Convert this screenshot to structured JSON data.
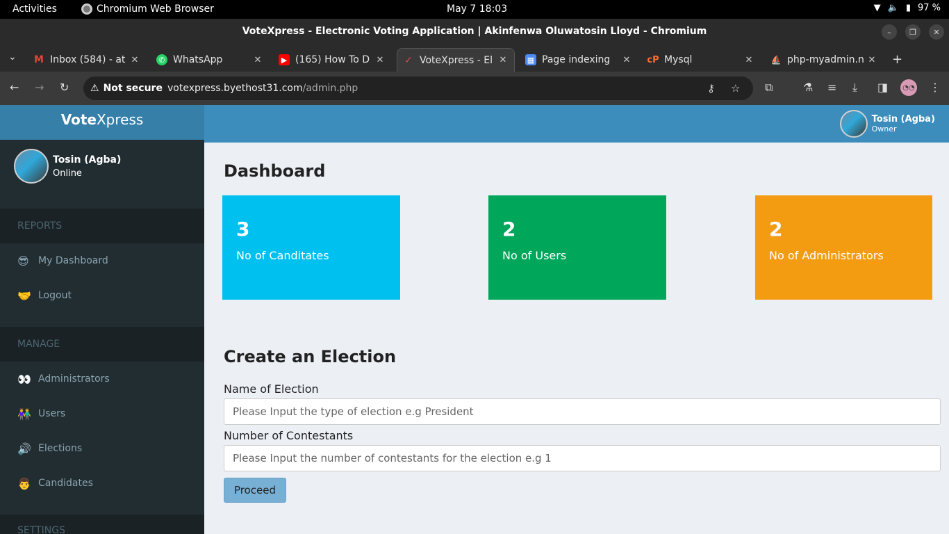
{
  "system": {
    "activities": "Activities",
    "app_name": "Chromium Web Browser",
    "clock": "May 7  18:03",
    "battery": "97 %"
  },
  "window": {
    "title": "VoteXpress - Electronic Voting Application | Akinfenwa Oluwatosin Lloyd - Chromium"
  },
  "tabs": [
    {
      "title": "Inbox (584) - at",
      "icon": "gmail-icon"
    },
    {
      "title": "WhatsApp",
      "icon": "whatsapp-icon"
    },
    {
      "title": "(165) How To D",
      "icon": "youtube-icon"
    },
    {
      "title": "VoteXpress - El",
      "icon": "votexpress-icon",
      "active": true
    },
    {
      "title": "Page indexing",
      "icon": "search-console-icon"
    },
    {
      "title": "Mysql",
      "icon": "cpanel-icon"
    },
    {
      "title": "php-myadmin.n",
      "icon": "phpmyadmin-icon"
    }
  ],
  "toolbar": {
    "security": "Not secure",
    "url_host": "votexpress.byethost31.com",
    "url_path": "/admin.php"
  },
  "app": {
    "logo_bold": "Vote",
    "logo_rest": "Xpress",
    "header_user_name": "Tosin (Agba)",
    "header_user_role": "Owner",
    "sidebar_user_name": "Tosin (Agba)",
    "sidebar_user_status": "Online"
  },
  "sidebar": {
    "reports_header": "REPORTS",
    "reports": [
      {
        "label": "My Dashboard",
        "emoji": "😎"
      },
      {
        "label": "Logout",
        "emoji": "🤝"
      }
    ],
    "manage_header": "MANAGE",
    "manage": [
      {
        "label": "Administrators",
        "emoji": "👀"
      },
      {
        "label": "Users",
        "emoji": "👫"
      },
      {
        "label": "Elections",
        "emoji": "🔊"
      },
      {
        "label": "Candidates",
        "emoji": "👨"
      }
    ],
    "settings_header": "SETTINGS"
  },
  "dashboard": {
    "title": "Dashboard",
    "cards": [
      {
        "value": "3",
        "label": "No of Canditates",
        "color": "#00c0ef"
      },
      {
        "value": "2",
        "label": "No of Users",
        "color": "#00a65a"
      },
      {
        "value": "2",
        "label": "No of Administrators",
        "color": "#f39c12"
      }
    ]
  },
  "election_form": {
    "title": "Create an Election",
    "name_label": "Name of Election",
    "name_placeholder": "Please Input the type of election e.g President",
    "contestants_label": "Number of Contestants",
    "contestants_placeholder": "Please Input the number of contestants for the election e.g 1",
    "submit_label": "Proceed"
  }
}
